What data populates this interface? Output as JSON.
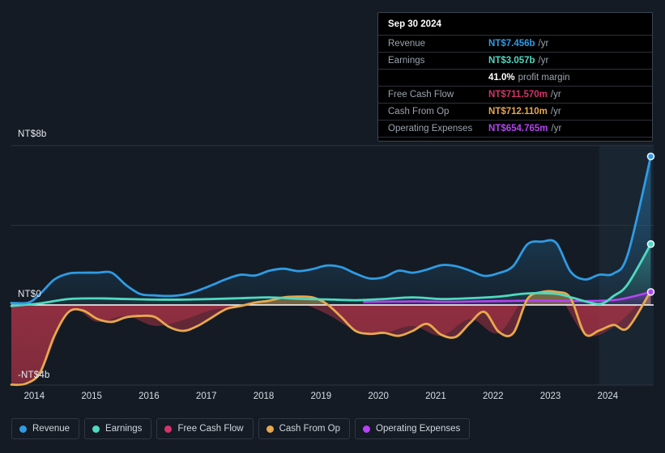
{
  "chart_data": {
    "type": "area",
    "title": "",
    "xlabel": "",
    "ylabel": "",
    "currency": "NT$",
    "xlim": [
      2013.6,
      2024.8
    ],
    "ylim": [
      -4,
      8
    ],
    "grid": true,
    "legend_position": "bottom",
    "y_ticks": [
      {
        "value": 8,
        "label": "NT$8b"
      },
      {
        "value": 4,
        "label": ""
      },
      {
        "value": 0,
        "label": "NT$0"
      },
      {
        "value": -4,
        "label": "-NT$4b"
      }
    ],
    "x_ticks": [
      {
        "value": 2014,
        "label": "2014"
      },
      {
        "value": 2015,
        "label": "2015"
      },
      {
        "value": 2016,
        "label": "2016"
      },
      {
        "value": 2017,
        "label": "2017"
      },
      {
        "value": 2018,
        "label": "2018"
      },
      {
        "value": 2019,
        "label": "2019"
      },
      {
        "value": 2020,
        "label": "2020"
      },
      {
        "value": 2021,
        "label": "2021"
      },
      {
        "value": 2022,
        "label": "2022"
      },
      {
        "value": 2023,
        "label": "2023"
      },
      {
        "value": 2024,
        "label": "2024"
      }
    ],
    "forecast_start": 2023.85,
    "series": [
      {
        "name": "Revenue",
        "color": "#2f9be3",
        "x": [
          2013.6,
          2013.9,
          2014.1,
          2014.35,
          2014.6,
          2014.85,
          2015.1,
          2015.35,
          2015.6,
          2015.85,
          2016.1,
          2016.35,
          2016.6,
          2016.85,
          2017.1,
          2017.35,
          2017.6,
          2017.85,
          2018.1,
          2018.35,
          2018.6,
          2018.85,
          2019.1,
          2019.35,
          2019.6,
          2019.85,
          2020.1,
          2020.35,
          2020.6,
          2020.85,
          2021.1,
          2021.35,
          2021.6,
          2021.85,
          2022.1,
          2022.35,
          2022.6,
          2022.85,
          2023.1,
          2023.35,
          2023.6,
          2023.85,
          2024.1,
          2024.35,
          2024.75
        ],
        "values": [
          0.1,
          0.12,
          0.55,
          1.28,
          1.58,
          1.62,
          1.62,
          1.62,
          1.0,
          0.55,
          0.48,
          0.45,
          0.52,
          0.72,
          1.0,
          1.3,
          1.52,
          1.48,
          1.72,
          1.82,
          1.7,
          1.8,
          1.98,
          1.9,
          1.58,
          1.33,
          1.4,
          1.72,
          1.62,
          1.78,
          2.0,
          1.95,
          1.72,
          1.46,
          1.6,
          1.95,
          3.05,
          3.18,
          3.12,
          1.68,
          1.28,
          1.52,
          1.58,
          2.55,
          7.456
        ]
      },
      {
        "name": "Earnings",
        "color": "#4fd9c0",
        "x": [
          2013.6,
          2014.1,
          2014.6,
          2015.1,
          2015.6,
          2016.1,
          2016.6,
          2017.1,
          2017.6,
          2018.1,
          2018.6,
          2019.1,
          2019.6,
          2020.1,
          2020.6,
          2021.1,
          2021.6,
          2022.1,
          2022.6,
          2023.1,
          2023.4,
          2023.85,
          2024.1,
          2024.35,
          2024.75
        ],
        "values": [
          -0.05,
          0.08,
          0.3,
          0.33,
          0.3,
          0.27,
          0.27,
          0.3,
          0.34,
          0.38,
          0.31,
          0.28,
          0.24,
          0.3,
          0.38,
          0.3,
          0.34,
          0.42,
          0.58,
          0.56,
          0.35,
          0.05,
          0.45,
          1.05,
          3.057
        ]
      },
      {
        "name": "Free Cash Flow",
        "color": "#d6336c",
        "x": [
          2013.6,
          2014.1,
          2014.6,
          2015.1,
          2015.6,
          2016.1,
          2016.6,
          2017.1,
          2017.6,
          2018.1,
          2018.6,
          2019.1,
          2019.6,
          2020.1,
          2020.6,
          2021.1,
          2021.6,
          2022.1,
          2022.6,
          2023.1,
          2023.6,
          2024.1,
          2024.75
        ],
        "values": [
          -3.95,
          -3.4,
          -0.3,
          -0.85,
          -0.55,
          -1.05,
          -0.75,
          -0.25,
          -0.1,
          0.15,
          0.12,
          -0.45,
          -1.25,
          -1.4,
          -1.05,
          -1.55,
          -0.7,
          -1.4,
          0.55,
          0.6,
          -1.45,
          -1.1,
          0.712
        ]
      },
      {
        "name": "Cash From Op",
        "color": "#e8a84d",
        "x": [
          2013.6,
          2013.85,
          2014.1,
          2014.35,
          2014.6,
          2014.85,
          2015.1,
          2015.35,
          2015.6,
          2015.85,
          2016.1,
          2016.35,
          2016.6,
          2016.85,
          2017.1,
          2017.35,
          2017.6,
          2017.85,
          2018.1,
          2018.35,
          2018.6,
          2018.85,
          2019.1,
          2019.35,
          2019.6,
          2019.85,
          2020.1,
          2020.35,
          2020.6,
          2020.85,
          2021.1,
          2021.35,
          2021.6,
          2021.85,
          2022.1,
          2022.35,
          2022.6,
          2022.85,
          2023.1,
          2023.35,
          2023.6,
          2023.85,
          2024.1,
          2024.35,
          2024.75
        ],
        "values": [
          -4.0,
          -3.95,
          -3.4,
          -1.55,
          -0.35,
          -0.28,
          -0.7,
          -0.85,
          -0.62,
          -0.55,
          -0.6,
          -1.1,
          -1.3,
          -1.05,
          -0.62,
          -0.2,
          -0.05,
          0.12,
          0.22,
          0.38,
          0.42,
          0.38,
          0.05,
          -0.6,
          -1.3,
          -1.45,
          -1.4,
          -1.55,
          -1.3,
          -0.95,
          -1.5,
          -1.6,
          -0.9,
          -0.35,
          -1.35,
          -1.42,
          0.3,
          0.65,
          0.66,
          0.35,
          -1.45,
          -1.28,
          -1.0,
          -1.15,
          0.712
        ]
      },
      {
        "name": "Operating Expenses",
        "color": "#b642f5",
        "x": [
          2019.75,
          2020.2,
          2020.7,
          2021.2,
          2021.7,
          2022.2,
          2022.7,
          2023.2,
          2023.7,
          2024.2,
          2024.75
        ],
        "values": [
          0.15,
          0.17,
          0.18,
          0.16,
          0.18,
          0.2,
          0.22,
          0.21,
          0.2,
          0.28,
          0.655
        ]
      }
    ]
  },
  "tooltip": {
    "date": "Sep 30 2024",
    "rows": [
      {
        "key": "Revenue",
        "value": "NT$7.456b",
        "unit": "/yr",
        "color": "#2f9be3"
      },
      {
        "key": "Earnings",
        "value": "NT$3.057b",
        "unit": "/yr",
        "color": "#4fd9c0"
      },
      {
        "key": "",
        "value": "41.0%",
        "unit": "profit margin",
        "color": "#ffffff"
      },
      {
        "key": "Free Cash Flow",
        "value": "NT$711.570m",
        "unit": "/yr",
        "color": "#d6336c"
      },
      {
        "key": "Cash From Op",
        "value": "NT$712.110m",
        "unit": "/yr",
        "color": "#e8a84d"
      },
      {
        "key": "Operating Expenses",
        "value": "NT$654.765m",
        "unit": "/yr",
        "color": "#b642f5"
      }
    ]
  },
  "legend": {
    "items": [
      {
        "label": "Revenue",
        "color": "#2f9be3"
      },
      {
        "label": "Earnings",
        "color": "#4fd9c0"
      },
      {
        "label": "Free Cash Flow",
        "color": "#d6336c"
      },
      {
        "label": "Cash From Op",
        "color": "#e8a84d"
      },
      {
        "label": "Operating Expenses",
        "color": "#b642f5"
      }
    ]
  },
  "colors": {
    "background": "#141b24",
    "gridline": "#2b3440",
    "zeroline": "#ffffff",
    "forecast_band": "#1b2935"
  }
}
